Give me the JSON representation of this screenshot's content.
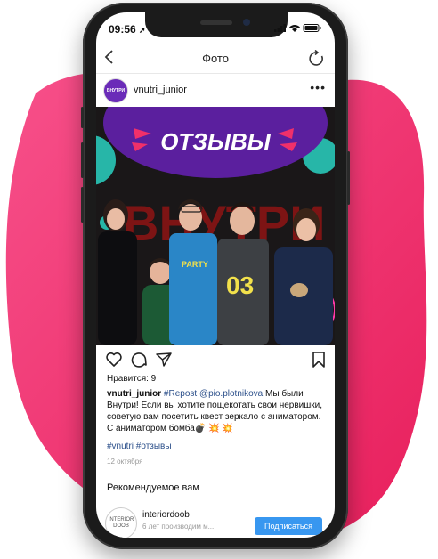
{
  "status": {
    "time": "09:56",
    "location_icon": "location-arrow-icon",
    "signal_icon": "signal-icon",
    "wifi_icon": "wifi-icon",
    "battery_icon": "battery-icon"
  },
  "nav": {
    "title": "Фото",
    "back_icon": "chevron-left-icon",
    "refresh_icon": "refresh-icon"
  },
  "post": {
    "username": "vnutri_junior",
    "avatar_text": "ВНУТРИ",
    "photo": {
      "banner_text": "ОТЗЫВЫ",
      "wall_text": "ВНУТРИ",
      "shirt_text": "PARTY",
      "shirt_number": "03"
    },
    "likes": "Нравится: 9",
    "caption_user": "vnutri_junior",
    "caption_tag": "#Repost",
    "caption_mention": "@pio.plotnikova",
    "caption_text": " Мы были Внутри! Если вы хотите пощекотать свои нервишки, советую вам посетить квест зеркало с аниматором. С аниматором бомба💣 💥 💥",
    "hashtags": "#vnutri #отзывы",
    "date": "12 октября"
  },
  "recommended": {
    "title": "Рекомендуемое вам",
    "user": {
      "name": "interiordoob",
      "avatar_text": "INTERIOR DOOB",
      "subtitle": "6 лет производим м...",
      "follow_label": "Подписаться"
    }
  },
  "colors": {
    "blob": "#f0306a",
    "accent": "#3897f0",
    "banner": "#5b1f9e"
  }
}
